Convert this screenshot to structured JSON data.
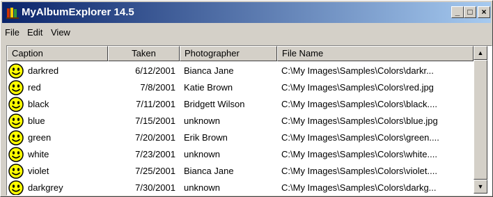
{
  "window": {
    "title": "MyAlbumExplorer 14.5"
  },
  "controls": {
    "minimize": "_",
    "maximize": "□",
    "close": "×"
  },
  "menu": [
    "File",
    "Edit",
    "View"
  ],
  "columns": [
    "Caption",
    "Taken",
    "Photographer",
    "File Name"
  ],
  "rows": [
    {
      "caption": "darkred",
      "taken": "6/12/2001",
      "photographer": "Bianca Jane",
      "file": "C:\\My Images\\Samples\\Colors\\darkr..."
    },
    {
      "caption": "red",
      "taken": "7/8/2001",
      "photographer": "Katie Brown",
      "file": "C:\\My Images\\Samples\\Colors\\red.jpg"
    },
    {
      "caption": "black",
      "taken": "7/11/2001",
      "photographer": "Bridgett Wilson",
      "file": "C:\\My Images\\Samples\\Colors\\black...."
    },
    {
      "caption": "blue",
      "taken": "7/15/2001",
      "photographer": "unknown",
      "file": "C:\\My Images\\Samples\\Colors\\blue.jpg"
    },
    {
      "caption": "green",
      "taken": "7/20/2001",
      "photographer": "Erik Brown",
      "file": "C:\\My Images\\Samples\\Colors\\green...."
    },
    {
      "caption": "white",
      "taken": "7/23/2001",
      "photographer": "unknown",
      "file": "C:\\My Images\\Samples\\Colors\\white...."
    },
    {
      "caption": "violet",
      "taken": "7/25/2001",
      "photographer": "Bianca Jane",
      "file": "C:\\My Images\\Samples\\Colors\\violet...."
    },
    {
      "caption": "darkgrey",
      "taken": "7/30/2001",
      "photographer": "unknown",
      "file": "C:\\My Images\\Samples\\Colors\\darkg..."
    }
  ],
  "icons": {
    "app": "album-icon",
    "row": "smiley-icon"
  },
  "colors": {
    "titlebar_start": "#0a246a",
    "titlebar_end": "#a6caf0",
    "face": "#d4d0c8",
    "smiley": "#ffff00"
  }
}
